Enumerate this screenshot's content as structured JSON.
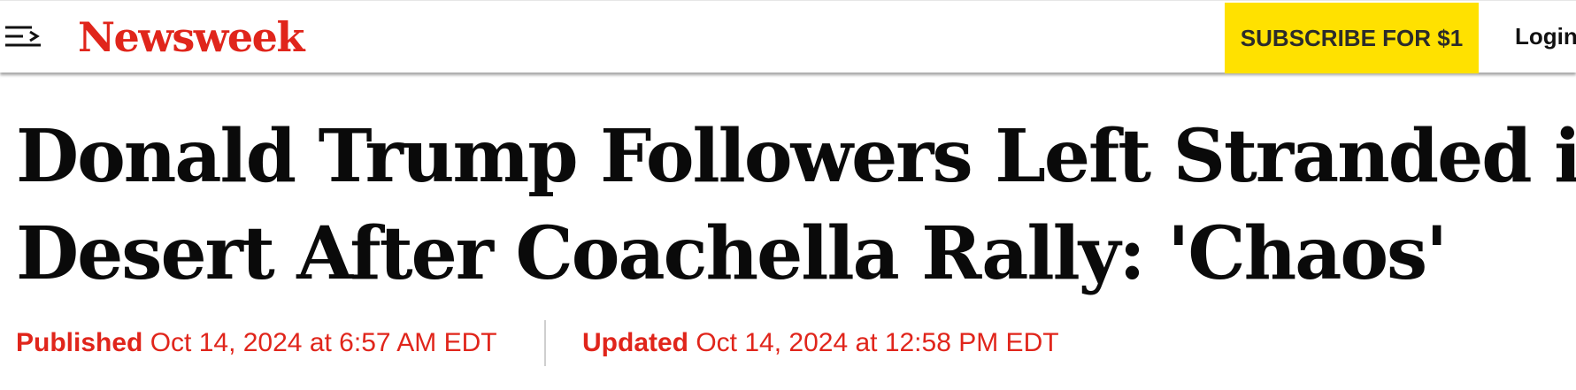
{
  "header": {
    "logo_text": "Newsweek",
    "subscribe_label": "SUBSCRIBE FOR $1",
    "login_label": "Login",
    "icons": [
      "menu-icon"
    ]
  },
  "article": {
    "headline_line1": "Donald Trump Followers Left Stranded in",
    "headline_line2": "Desert After Coachella Rally: 'Chaos'",
    "published_label": "Published",
    "published_date": "Oct 14, 2024 at 6:57 AM EDT",
    "updated_label": "Updated",
    "updated_date": "Oct 14, 2024 at 12:58 PM EDT"
  },
  "colors": {
    "brand_red": "#e0251b",
    "subscribe_yellow": "#ffe100",
    "headline_text": "#0a0a0a"
  }
}
